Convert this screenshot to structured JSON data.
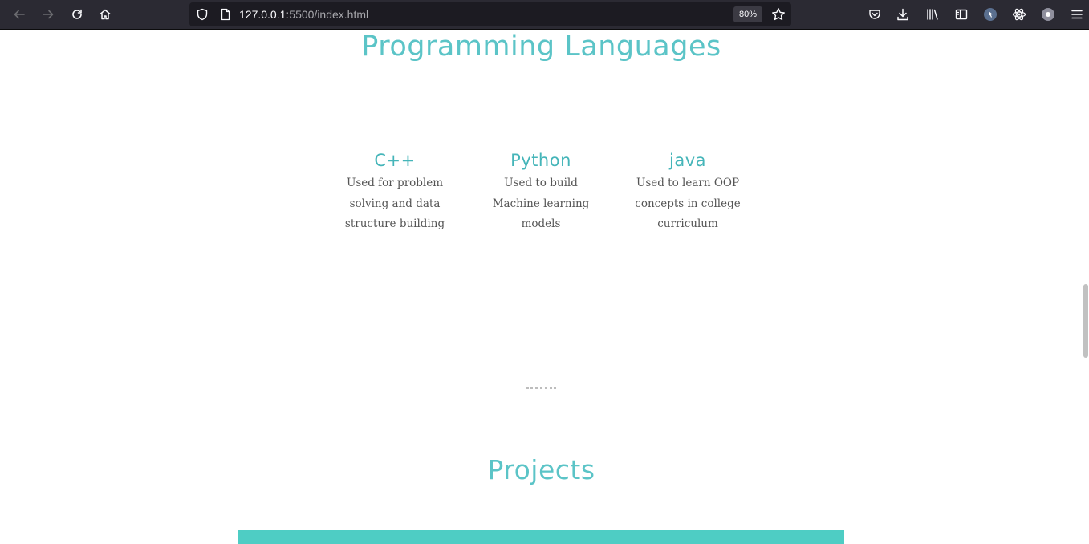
{
  "browser": {
    "url_host": "127.0.0.1",
    "url_path": ":5500/index.html",
    "zoom": "80%",
    "icons": [
      "back-icon",
      "forward-icon",
      "reload-icon",
      "home-icon",
      "shield-icon",
      "page-icon",
      "bookmark-star-icon",
      "pocket-icon",
      "download-icon",
      "library-icon",
      "sidebar-icon",
      "extension-icon",
      "react-devtools-icon",
      "account-icon",
      "menu-icon"
    ]
  },
  "sections": {
    "languages": {
      "title": "Programming Languages",
      "items": [
        {
          "name": "C++",
          "description": [
            "Used for problem",
            "solving and data",
            "structure building"
          ]
        },
        {
          "name": "Python",
          "description": [
            "Used to build",
            "Machine learning",
            "models"
          ]
        },
        {
          "name": "java",
          "description": [
            "Used to learn OOP",
            "concepts in college",
            "curriculum"
          ]
        }
      ]
    },
    "projects": {
      "title": "Projects"
    }
  },
  "colors": {
    "accent": "#5bc4c7",
    "project_bar": "#4ecdc4",
    "toolbar": "#2b2a33"
  }
}
